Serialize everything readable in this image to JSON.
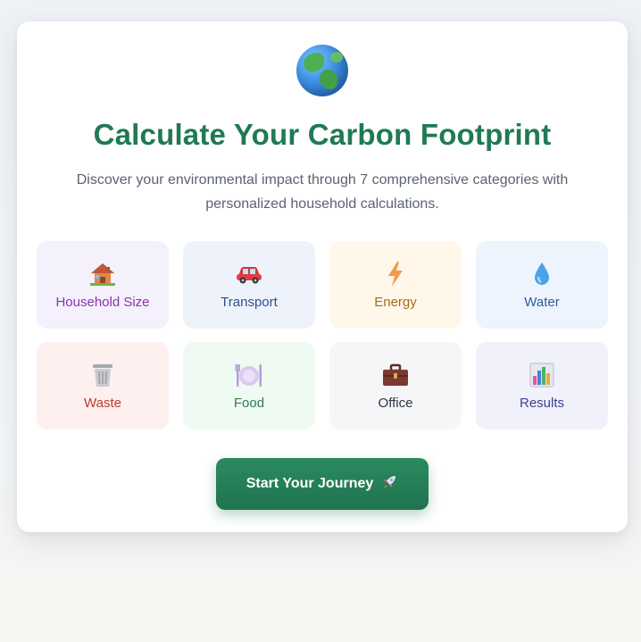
{
  "hero": {
    "icon": "globe-icon",
    "title": "Calculate Your Carbon Footprint",
    "subtitle": "Discover your environmental impact through 7 comprehensive categories with personalized household calculations."
  },
  "categories": [
    {
      "label": "Household Size",
      "icon": "house-icon",
      "color": "#8e2fb4",
      "bg": "#f4f1fc"
    },
    {
      "label": "Transport",
      "icon": "car-icon",
      "color": "#2f4f8f",
      "bg": "#eef2fb"
    },
    {
      "label": "Energy",
      "icon": "lightning-icon",
      "color": "#a86a1c",
      "bg": "#fff8ea"
    },
    {
      "label": "Water",
      "icon": "water-drop-icon",
      "color": "#2f5c9a",
      "bg": "#eef4fd"
    },
    {
      "label": "Waste",
      "icon": "trash-can-icon",
      "color": "#c0392b",
      "bg": "#fdf0ef"
    },
    {
      "label": "Food",
      "icon": "plate-cutlery-icon",
      "color": "#2f7a4f",
      "bg": "#effaf2"
    },
    {
      "label": "Office",
      "icon": "briefcase-icon",
      "color": "#2f3440",
      "bg": "#f5f6f8"
    },
    {
      "label": "Results",
      "icon": "bar-chart-icon",
      "color": "#3d3f8f",
      "bg": "#f0f1fb"
    }
  ],
  "cta": {
    "label": "Start Your Journey",
    "icon": "rocket-icon"
  }
}
